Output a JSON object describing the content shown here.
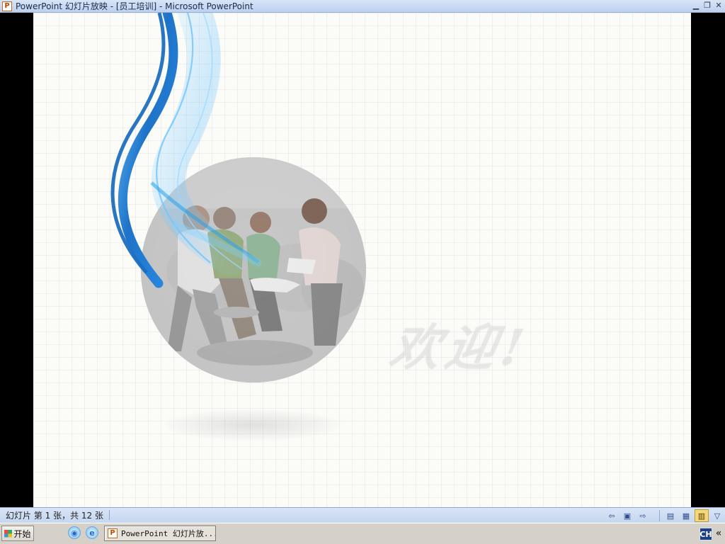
{
  "window": {
    "title": "PowerPoint 幻灯片放映 - [员工培训] - Microsoft PowerPoint",
    "app_icon": "powerpoint-icon",
    "controls": {
      "minimize": "minimize-icon",
      "restore": "restore-icon",
      "close": "close-icon"
    }
  },
  "slide": {
    "welcome_text": "欢迎!",
    "decorative_ribbon_color": "#1e73c8",
    "decorative_ribbon_highlight": "#5db6f3",
    "photo_description": "people-meeting-photo"
  },
  "status_bar": {
    "slide_count": "幻灯片 第 1 张，共 12 张",
    "buttons": {
      "previous_icon": "previous-slide-icon",
      "menu_icon": "slide-menu-icon",
      "next_icon": "next-slide-icon",
      "normal_view_icon": "normal-view-icon",
      "sorter_view_icon": "slide-sorter-icon",
      "reading_view_icon": "reading-view-icon",
      "slideshow_icon": "slideshow-icon"
    }
  },
  "taskbar": {
    "start_label": "开始",
    "quick_launch": [
      "browser-icon",
      "internet-explorer-icon"
    ],
    "task_button_label": "PowerPoint 幻灯片放...",
    "language_indicator": "CH",
    "tray_expand_icon": "double-left-chevron-icon"
  }
}
